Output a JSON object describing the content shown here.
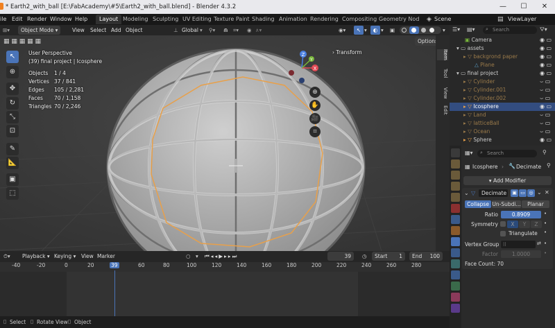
{
  "titlebar": {
    "title": "* Earth2_with_ball [E:\\FabAcademy\\#5\\Earth2_with_ball.blend] - Blender 4.3.2",
    "minimize": "—",
    "maximize": "☐",
    "close": "✕"
  },
  "menubar": {
    "items": [
      "ile",
      "Edit",
      "Render",
      "Window",
      "Help"
    ],
    "workspaces": [
      "Layout",
      "Modeling",
      "Sculpting",
      "UV Editing",
      "Texture Paint",
      "Shading",
      "Animation",
      "Rendering",
      "Compositing",
      "Geometry Nod"
    ],
    "scene": "Scene",
    "viewlayer": "ViewLayer"
  },
  "viewport_header": {
    "mode": "Object Mode",
    "menus": [
      "View",
      "Select",
      "Add",
      "Object"
    ],
    "orientation": "Global",
    "options": "Options"
  },
  "overlay": {
    "view_name": "User Perspective",
    "context": "(39) final project | Icosphere",
    "stats": [
      {
        "label": "Objects",
        "value": "1 / 4"
      },
      {
        "label": "Vertices",
        "value": "37 / 841"
      },
      {
        "label": "Edges",
        "value": "105 / 2,281"
      },
      {
        "label": "Faces",
        "value": "70 / 1,158"
      },
      {
        "label": "Triangles",
        "value": "70 / 2,246"
      }
    ],
    "transform": "Transform",
    "gizmo_axes": {
      "x": "X",
      "y": "Y",
      "z": "Z"
    }
  },
  "sidetabs": [
    "Item",
    "Tool",
    "View",
    "Edit"
  ],
  "timeline": {
    "menus": [
      "Playback",
      "Keying",
      "View",
      "Marker"
    ],
    "current_frame": "39",
    "start_label": "Start",
    "start": "1",
    "end_label": "End",
    "end": "100",
    "ticks": [
      "-40",
      "-20",
      "0",
      "20",
      "39",
      "60",
      "80",
      "100",
      "120",
      "140",
      "160",
      "180",
      "200",
      "220",
      "240",
      "260",
      "280"
    ]
  },
  "statusbar": {
    "items": [
      "Select",
      "Rotate View",
      "Object"
    ]
  },
  "outliner": {
    "search_placeholder": "Search",
    "rows": [
      {
        "name": "Camera",
        "indent": 2,
        "sel": false,
        "type": "cam"
      },
      {
        "name": "assets",
        "indent": 1,
        "sel": false,
        "type": "col"
      },
      {
        "name": "backgrond paper",
        "indent": 2,
        "sel": false,
        "type": "obj"
      },
      {
        "name": "Plane",
        "indent": 3,
        "sel": false,
        "type": "mesh"
      },
      {
        "name": "final project",
        "indent": 1,
        "sel": false,
        "type": "col"
      },
      {
        "name": "Cylinder",
        "indent": 2,
        "sel": false,
        "type": "obj"
      },
      {
        "name": "Cylinder.001",
        "indent": 2,
        "sel": false,
        "type": "obj"
      },
      {
        "name": "Cylinder.002",
        "indent": 2,
        "sel": false,
        "type": "obj"
      },
      {
        "name": "Icosphere",
        "indent": 2,
        "sel": true,
        "type": "obj"
      },
      {
        "name": "Land",
        "indent": 2,
        "sel": false,
        "type": "obj"
      },
      {
        "name": "latticeBall",
        "indent": 2,
        "sel": false,
        "type": "obj"
      },
      {
        "name": "Ocean",
        "indent": 2,
        "sel": false,
        "type": "obj"
      },
      {
        "name": "Sphere",
        "indent": 2,
        "sel": false,
        "type": "obj"
      }
    ]
  },
  "properties": {
    "search_placeholder": "Search",
    "object": "Icosphere",
    "modifier_tab": "Decimate",
    "add_modifier": "Add Modifier",
    "modifier_name": "Decimate",
    "modes": [
      "Collapse",
      "Un-Subdi...",
      "Planar"
    ],
    "ratio_label": "Ratio",
    "ratio": "0.8909",
    "symmetry_label": "Symmetry",
    "axes": [
      "X",
      "Y",
      "Z"
    ],
    "triangulate": "Triangulate",
    "vertex_group_label": "Vertex Group",
    "factor_label": "Factor",
    "factor": "1.0000",
    "face_count": "Face Count: 70"
  },
  "colors": {
    "accent": "#4a74b8",
    "selection": "#e8a04a",
    "active_frame": "#4a74b8"
  }
}
